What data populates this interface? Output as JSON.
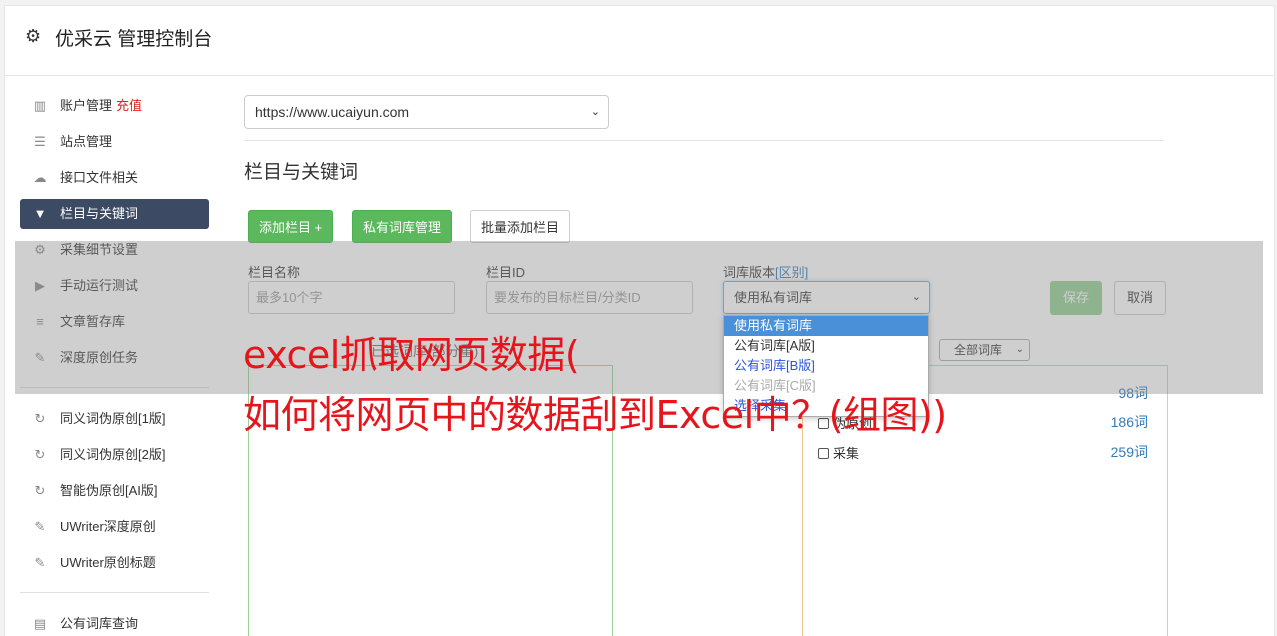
{
  "header": {
    "title": "优采云 管理控制台"
  },
  "sidebar": {
    "items": [
      {
        "label": "账户管理",
        "extra": "充值"
      },
      {
        "label": "站点管理"
      },
      {
        "label": "接口文件相关"
      },
      {
        "label": "栏目与关键词"
      },
      {
        "label": "采集细节设置"
      },
      {
        "label": "手动运行测试"
      },
      {
        "label": "文章暂存库"
      },
      {
        "label": "深度原创任务"
      }
    ],
    "items2": [
      {
        "label": "同义词伪原创[1版]"
      },
      {
        "label": "同义词伪原创[2版]"
      },
      {
        "label": "智能伪原创[AI版]"
      },
      {
        "label": "UWriter深度原创"
      },
      {
        "label": "UWriter原创标题"
      }
    ],
    "items3": [
      {
        "label": "公有词库查询"
      }
    ]
  },
  "main": {
    "site_select": "https://www.ucaiyun.com",
    "section_title": "栏目与关键词",
    "buttons": {
      "add_column": "添加栏目 +",
      "private_lib": "私有词库管理",
      "batch_add": "批量添加栏目"
    },
    "form": {
      "name_label": "栏目名称",
      "name_placeholder": "最多10个字",
      "id_label": "栏目ID",
      "id_placeholder": "要发布的目标栏目/分类ID",
      "lib_label": "词库版本",
      "lib_link": "[区别]",
      "lib_value": "使用私有词库",
      "save": "保存",
      "cancel": "取消"
    },
    "dropdown_options": [
      "使用私有词库",
      "公有词库[A版]",
      "公有词库[B版]",
      "公有词库[C版]",
      "选择采集"
    ],
    "selected_caption": "已选词库(部分重)",
    "filter_select": "全部词库",
    "libraries": [
      {
        "name": "",
        "count": "98词"
      },
      {
        "name": "伪原创",
        "count": "186词"
      },
      {
        "name": "采集",
        "count": "259词"
      }
    ]
  },
  "watermark": {
    "line1": "excel抓取网页数据(",
    "line2": "如何将网页中的数据刮到Excel中？(组图))"
  }
}
